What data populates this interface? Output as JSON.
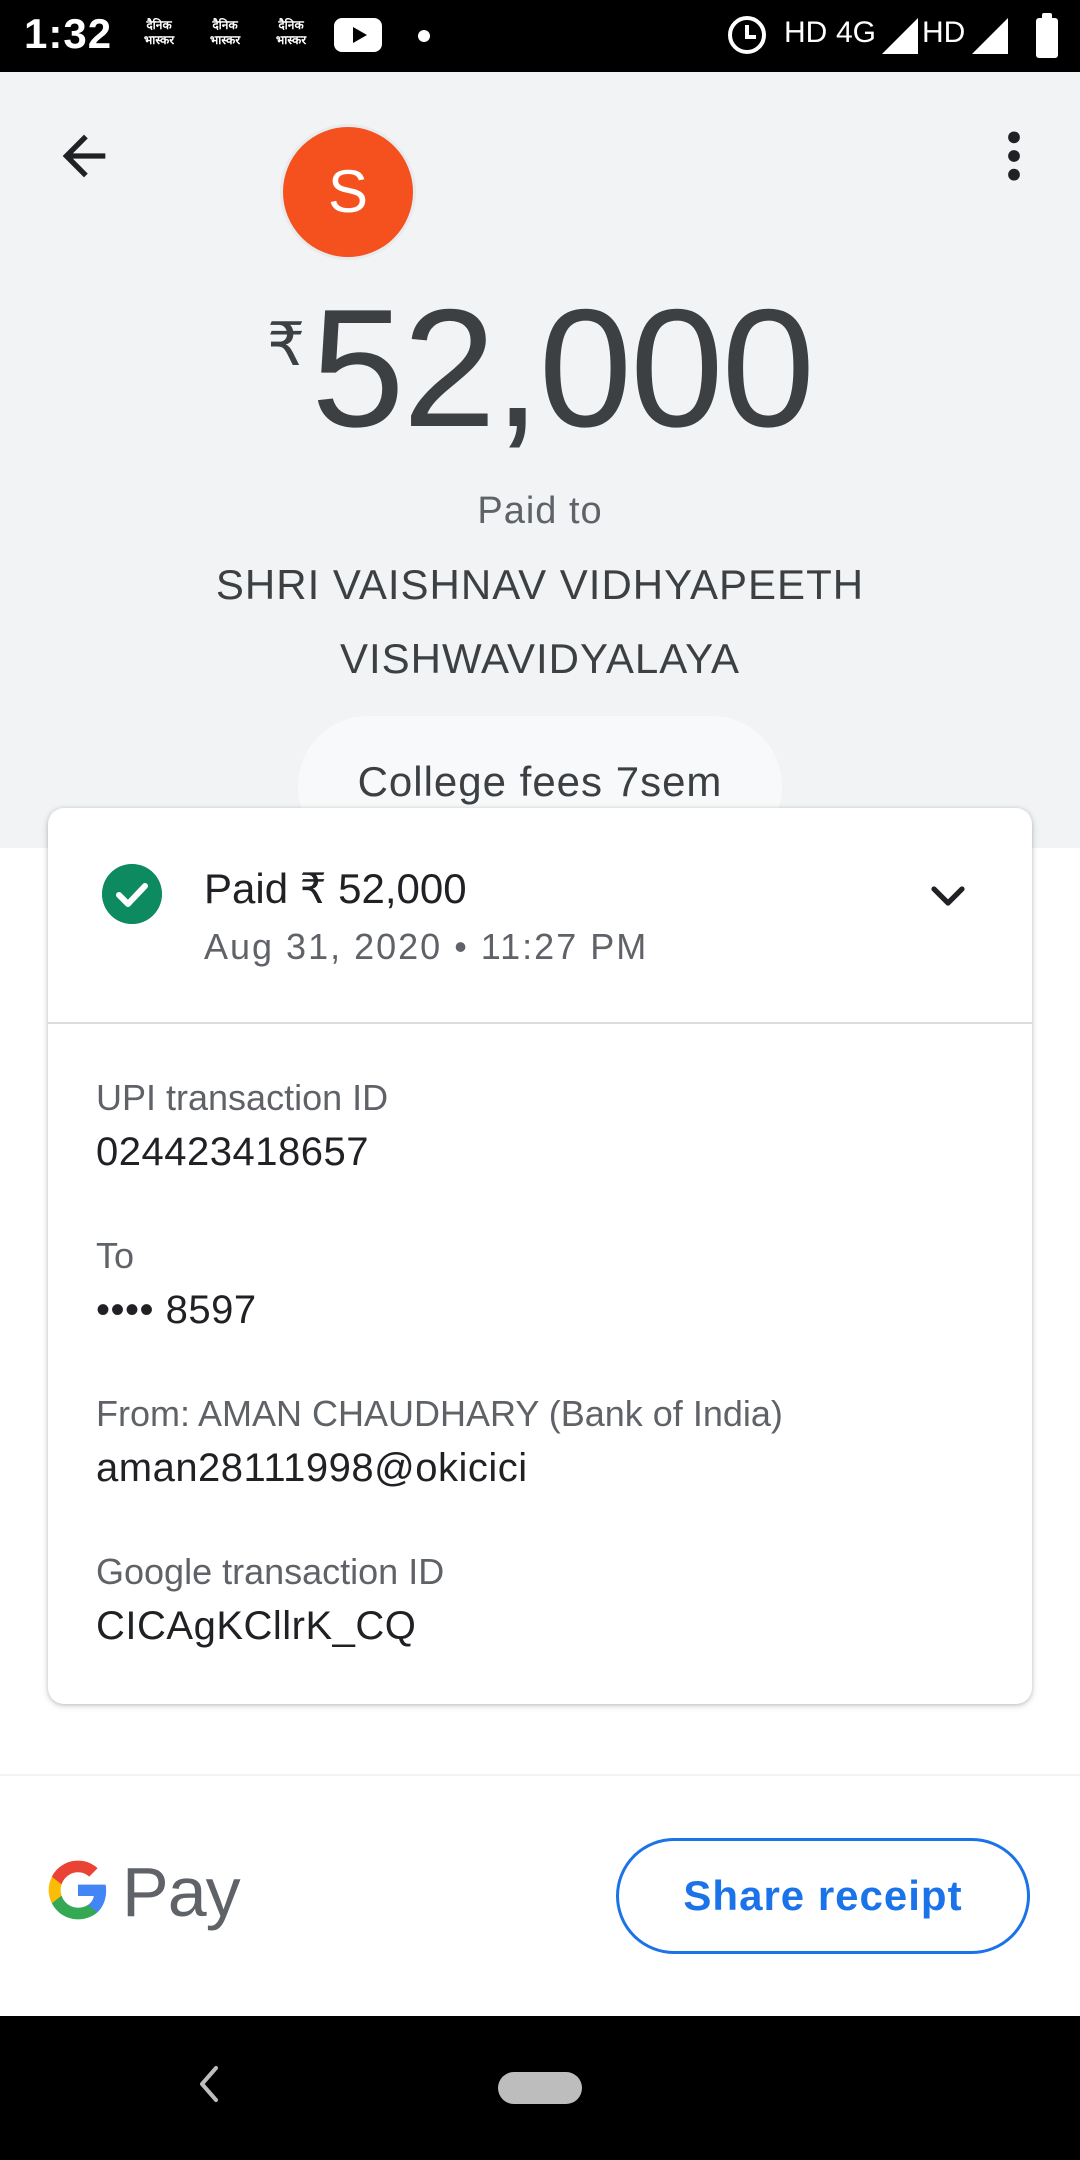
{
  "status_bar": {
    "time": "1:32",
    "notification_icons": [
      "दैनिक भास्कर",
      "दैनिक भास्कर",
      "दैनिक भास्कर"
    ],
    "network": [
      "HD",
      "4G",
      "HD"
    ]
  },
  "header": {
    "avatar_letter": "S",
    "currency_symbol": "₹",
    "amount": "52,000",
    "paid_to_label": "Paid to",
    "payee_line1": "SHRI VAISHNAV VIDHYAPEETH",
    "payee_line2": "VISHWAVIDYALAYA",
    "note": "College fees 7sem"
  },
  "card": {
    "status_text": "Paid ₹ 52,000",
    "datetime": "Aug 31, 2020 • 11:27 PM",
    "details": [
      {
        "label": "UPI transaction ID",
        "value": "024423418657"
      },
      {
        "label": "To",
        "value": "•••• 8597"
      },
      {
        "label": "From: AMAN CHAUDHARY (Bank of India)",
        "value": "aman28111998@okicici"
      },
      {
        "label": "Google transaction ID",
        "value": "CICAgKCllrK_CQ"
      }
    ]
  },
  "footer": {
    "brand_text": "Pay",
    "share_label": "Share receipt"
  },
  "colors": {
    "accent": "#1a73e8",
    "avatar": "#f4511e",
    "success": "#0d8a5f",
    "header_bg": "#f1f3f4"
  }
}
